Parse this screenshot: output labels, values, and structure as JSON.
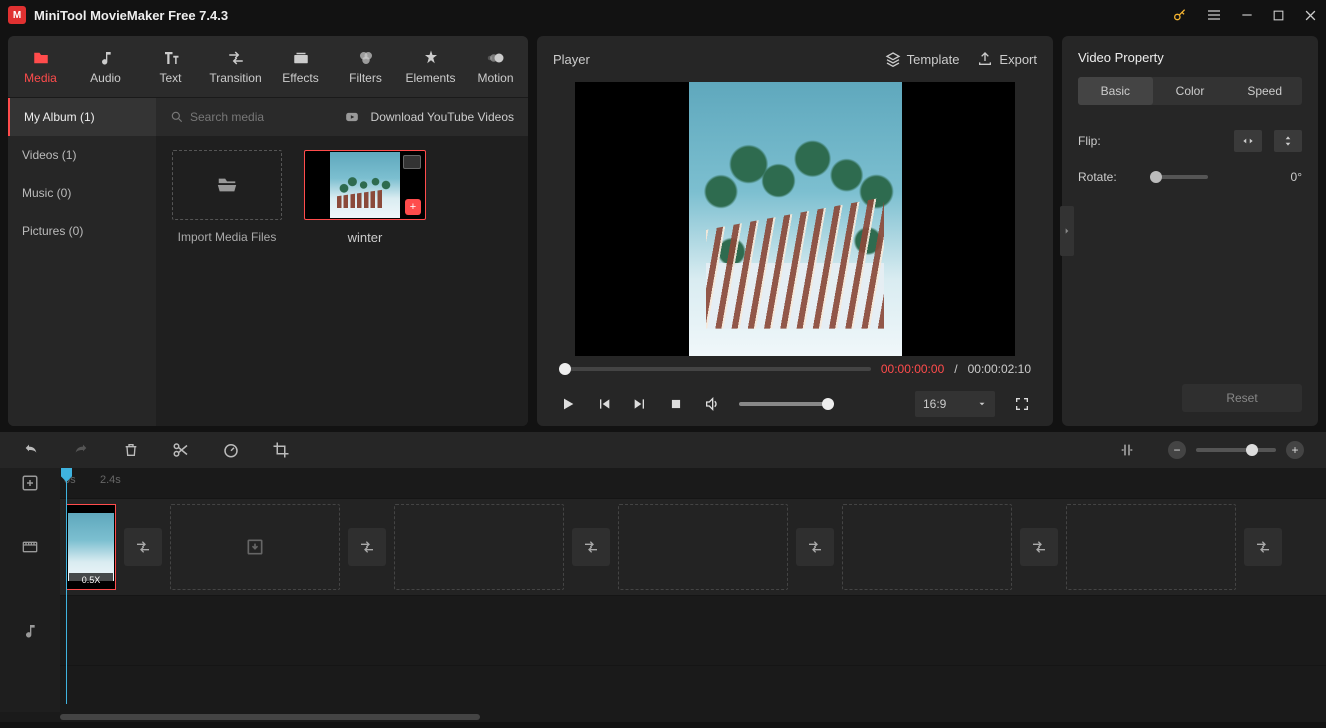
{
  "app": {
    "title": "MiniTool MovieMaker Free 7.4.3"
  },
  "tabs": {
    "media": "Media",
    "audio": "Audio",
    "text": "Text",
    "transition": "Transition",
    "effects": "Effects",
    "filters": "Filters",
    "elements": "Elements",
    "motion": "Motion"
  },
  "album": {
    "myalbum": "My Album (1)",
    "videos": "Videos (1)",
    "music": "Music (0)",
    "pictures": "Pictures (0)",
    "search_placeholder": "Search media",
    "download": "Download YouTube Videos",
    "import": "Import Media Files",
    "clip1": "winter"
  },
  "player": {
    "title": "Player",
    "template": "Template",
    "export": "Export",
    "cur": "00:00:00:00",
    "sep": "/",
    "tot": "00:00:02:10",
    "ratio": "16:9"
  },
  "property": {
    "title": "Video Property",
    "tab_basic": "Basic",
    "tab_color": "Color",
    "tab_speed": "Speed",
    "flip": "Flip:",
    "rotate": "Rotate:",
    "rotate_val": "0°",
    "reset": "Reset"
  },
  "ruler": {
    "t0": "0s",
    "t1": "2.4s"
  },
  "timeline": {
    "clip_speed": "0.5X"
  }
}
